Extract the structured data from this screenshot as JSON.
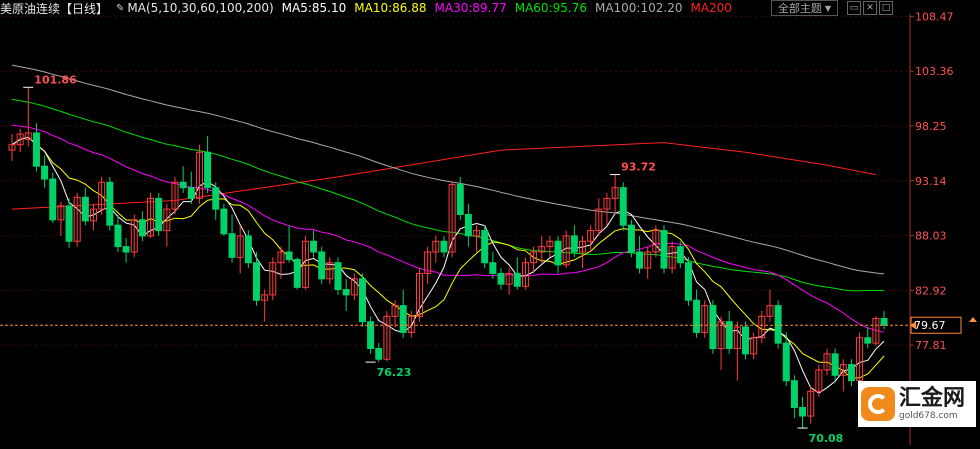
{
  "header": {
    "instrument": "美原油连续",
    "period": "【日线】",
    "ma_title": "MA(5,10,30,60,100,200)",
    "ma5": "MA5:85.10",
    "ma10": "MA10:86.88",
    "ma30": "MA30:89.77",
    "ma60": "MA60:95.76",
    "ma100": "MA100:102.20",
    "ma200": "MA200",
    "theme_label": "全部主题",
    "caret": "▼",
    "win_min": "▭",
    "win_close": "✕",
    "win_max": "□"
  },
  "colors": {
    "up": "#ff3c3c",
    "down": "#00d26a",
    "ma5": "#ffffff",
    "ma10": "#ffff00",
    "ma30": "#ff00ff",
    "ma60": "#00e000",
    "ma100": "#aaaaaa",
    "ma200": "#ff2020",
    "axis": "#a33030",
    "grid": "#3a0a0a",
    "price_label": "#ff5050",
    "last_price": "#ff8c3c"
  },
  "watermark": {
    "brand": "汇金网",
    "url": "gold678.com"
  },
  "chart_data": {
    "type": "candlestick",
    "title": "美原油连续 日线",
    "ylim": [
      68.5,
      110
    ],
    "yticks": [
      108.47,
      103.36,
      98.25,
      93.14,
      88.03,
      82.92,
      77.81
    ],
    "last_price": 79.67,
    "annotations": [
      {
        "text": "101.86",
        "index": 2,
        "price": 101.86,
        "kind": "high"
      },
      {
        "text": "76.23",
        "index": 44,
        "price": 76.23,
        "kind": "low"
      },
      {
        "text": "93.72",
        "index": 74,
        "price": 93.72,
        "kind": "high"
      },
      {
        "text": "70.08",
        "index": 97,
        "price": 70.08,
        "kind": "low"
      }
    ],
    "candles": [
      [
        96,
        97.5,
        95,
        96.5
      ],
      [
        96.5,
        98,
        95.8,
        97.5
      ],
      [
        97,
        101.86,
        96.3,
        97.6
      ],
      [
        97.6,
        98.5,
        94,
        94.5
      ],
      [
        94.5,
        95.5,
        92.5,
        93.3
      ],
      [
        93.3,
        93.9,
        89.2,
        89.5
      ],
      [
        89.5,
        91.2,
        88,
        90.8
      ],
      [
        90.8,
        91.5,
        86.9,
        87.5
      ],
      [
        87.5,
        92,
        87,
        91.6
      ],
      [
        91.6,
        92.5,
        89,
        89.4
      ],
      [
        89.4,
        91,
        88.5,
        90.5
      ],
      [
        90.5,
        93.5,
        90,
        93
      ],
      [
        93,
        93.5,
        88.5,
        89
      ],
      [
        89,
        90,
        86.5,
        87
      ],
      [
        87,
        87.8,
        85.5,
        86.5
      ],
      [
        86.5,
        90,
        86,
        89.5
      ],
      [
        89.5,
        90.3,
        87.5,
        88
      ],
      [
        88,
        92,
        87.8,
        91.5
      ],
      [
        91.5,
        92,
        88,
        88.5
      ],
      [
        88.5,
        91,
        87,
        90.5
      ],
      [
        90.5,
        93.5,
        90,
        93
      ],
      [
        93,
        94.5,
        92,
        92.5
      ],
      [
        92.5,
        94,
        91,
        91.5
      ],
      [
        91.5,
        96.5,
        91,
        95.8
      ],
      [
        95.8,
        97.3,
        92,
        92.5
      ],
      [
        92.5,
        93,
        89.5,
        90.5
      ],
      [
        90.5,
        91,
        88,
        88.2
      ],
      [
        88.2,
        90,
        85.5,
        86
      ],
      [
        86,
        89,
        84.5,
        88
      ],
      [
        88,
        88.5,
        85,
        85.5
      ],
      [
        85.5,
        86.5,
        81.5,
        82
      ],
      [
        82,
        83,
        80,
        82.5
      ],
      [
        82.5,
        86,
        82,
        85.5
      ],
      [
        85.5,
        87,
        84,
        86.5
      ],
      [
        86.5,
        89,
        85.5,
        85.8
      ],
      [
        85.8,
        86,
        83,
        83.2
      ],
      [
        83.2,
        88,
        83,
        87.5
      ],
      [
        87.5,
        88.5,
        86,
        86.5
      ],
      [
        86.5,
        87,
        83.5,
        84
      ],
      [
        84,
        86,
        83.5,
        85.5
      ],
      [
        85.5,
        86,
        82.5,
        83
      ],
      [
        83,
        84,
        81,
        82.5
      ],
      [
        82.5,
        84.5,
        82,
        84
      ],
      [
        84,
        84.5,
        79.5,
        80
      ],
      [
        80,
        80.5,
        77,
        77.5
      ],
      [
        77.5,
        78,
        76.23,
        76.5
      ],
      [
        76.5,
        81,
        76.3,
        80.5
      ],
      [
        80.5,
        82,
        79.5,
        81.5
      ],
      [
        81.5,
        83,
        78.5,
        79
      ],
      [
        79,
        81,
        78.5,
        80.5
      ],
      [
        80.5,
        85,
        80,
        84.5
      ],
      [
        84.5,
        87,
        83.5,
        86.5
      ],
      [
        86.5,
        88,
        85.5,
        87.5
      ],
      [
        87.5,
        88,
        86,
        86.5
      ],
      [
        86.5,
        93,
        86,
        92.8
      ],
      [
        92.8,
        93.5,
        89.5,
        90
      ],
      [
        90,
        91,
        87,
        88
      ],
      [
        88,
        89,
        86.5,
        88.5
      ],
      [
        88.5,
        89,
        85,
        85.5
      ],
      [
        85.5,
        86.5,
        84,
        84.5
      ],
      [
        84.5,
        85,
        83,
        83.5
      ],
      [
        83.5,
        85,
        82.5,
        84.5
      ],
      [
        84.5,
        86,
        83,
        83.3
      ],
      [
        83.3,
        86,
        83,
        85.5
      ],
      [
        85.5,
        87,
        84.5,
        86.5
      ],
      [
        86.5,
        88,
        85.5,
        87
      ],
      [
        87,
        88,
        86,
        87.5
      ],
      [
        87.5,
        88,
        84.5,
        85.3
      ],
      [
        85.3,
        88.5,
        85,
        88
      ],
      [
        88,
        89,
        86,
        86.5
      ],
      [
        86.5,
        88,
        85,
        87.5
      ],
      [
        87.5,
        89,
        86.5,
        88.5
      ],
      [
        88.5,
        91.5,
        88,
        90.5
      ],
      [
        90.5,
        92,
        89,
        91.5
      ],
      [
        91.5,
        93.72,
        90,
        92.5
      ],
      [
        92.5,
        93,
        88.5,
        89
      ],
      [
        89,
        89.5,
        86,
        86.5
      ],
      [
        86.5,
        88,
        84.5,
        85
      ],
      [
        85,
        87,
        84,
        86.5
      ],
      [
        86.5,
        89,
        86,
        88.5
      ],
      [
        88.5,
        89,
        84.5,
        85
      ],
      [
        85,
        87.5,
        84.5,
        87
      ],
      [
        87,
        87.5,
        85,
        85.5
      ],
      [
        85.5,
        86,
        81.5,
        82
      ],
      [
        82,
        83,
        78.5,
        79
      ],
      [
        79,
        82,
        78.5,
        81.5
      ],
      [
        81.5,
        82,
        77,
        77.5
      ],
      [
        77.5,
        80.5,
        75.5,
        80
      ],
      [
        80,
        81,
        77,
        77.5
      ],
      [
        77.5,
        80,
        74.5,
        79.5
      ],
      [
        79.5,
        80,
        76.5,
        77
      ],
      [
        77,
        79,
        76.5,
        78.5
      ],
      [
        78.5,
        81,
        78,
        80.5
      ],
      [
        80.5,
        83,
        80,
        81.5
      ],
      [
        81.5,
        82,
        77.5,
        78
      ],
      [
        78,
        79,
        74,
        74.5
      ],
      [
        74.5,
        75,
        71,
        72
      ],
      [
        72,
        73,
        70.08,
        71.2
      ],
      [
        71.2,
        74,
        70.5,
        73.5
      ],
      [
        73.5,
        76,
        73,
        75.5
      ],
      [
        75.5,
        77.5,
        75,
        77
      ],
      [
        77,
        77.5,
        74.5,
        75
      ],
      [
        75,
        76.5,
        73.5,
        76
      ],
      [
        76,
        76.5,
        74,
        74.5
      ],
      [
        74.5,
        79,
        74.3,
        78.5
      ],
      [
        78.5,
        79.5,
        77.5,
        78
      ],
      [
        78,
        80.5,
        77.8,
        80.3
      ],
      [
        80.3,
        81,
        79.3,
        79.67
      ]
    ],
    "ma200_points": [
      [
        0,
        90.5
      ],
      [
        20,
        91.3
      ],
      [
        40,
        93.5
      ],
      [
        60,
        96
      ],
      [
        80,
        96.7
      ],
      [
        90,
        95.8
      ],
      [
        100,
        94.6
      ],
      [
        106,
        93.7
      ]
    ]
  }
}
